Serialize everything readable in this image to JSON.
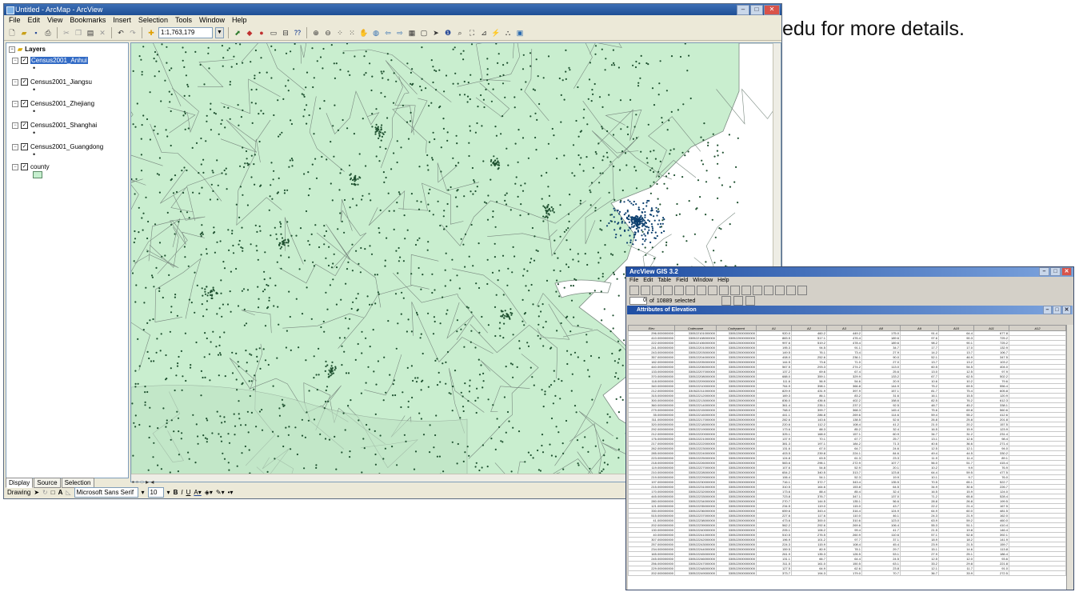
{
  "background_text": "edu for more details.",
  "arcmap": {
    "title": "Untitled - ArcMap - ArcView",
    "menu": [
      "File",
      "Edit",
      "View",
      "Bookmarks",
      "Insert",
      "Selection",
      "Tools",
      "Window",
      "Help"
    ],
    "scale": "1:1,763,179",
    "toc": {
      "root": "Layers",
      "layers": [
        {
          "name": "Census2001_Anhui",
          "symbol": "dot",
          "selected": true
        },
        {
          "name": "Census2001_Jiangsu",
          "symbol": "dot",
          "selected": false
        },
        {
          "name": "Census2001_Zhejiang",
          "symbol": "dot",
          "selected": false
        },
        {
          "name": "Census2001_Shanghai",
          "symbol": "dot",
          "selected": false
        },
        {
          "name": "Census2001_Guangdong",
          "symbol": "dot",
          "selected": false
        },
        {
          "name": "county",
          "symbol": "polygon",
          "selected": false
        }
      ],
      "tabs": [
        "Display",
        "Source",
        "Selection"
      ]
    },
    "drawing": {
      "label": "Drawing",
      "font": "Microsoft Sans Serif",
      "size": "10",
      "format": [
        "B",
        "I",
        "U"
      ]
    },
    "colors": {
      "land": "#c9eecf",
      "water": "#ffffff",
      "boundary": "#7a8a80",
      "dot": "#1f5130",
      "dot_dense": "#0c3f6e",
      "selection": "#316ac5"
    }
  },
  "arcview": {
    "title": "ArcView GIS 3.2",
    "menu": [
      "File",
      "Edit",
      "Table",
      "Field",
      "Window",
      "Help"
    ],
    "selected_label": "selected",
    "selected_count": "0",
    "of": "of",
    "total_count": "10889",
    "table_title": "Attributes of Elevation",
    "columns": [
      "Elev",
      "Codename",
      "Codeparent",
      "A1",
      "A2",
      "A3",
      "A8",
      "A9",
      "A10",
      "A11",
      "A12"
    ],
    "rows": [
      [
        "296.000000000",
        "330522101000000",
        "330522000000000",
        "920.0",
        "460.2",
        "449.2",
        "175.0",
        "91.4",
        "64.4",
        "677.8",
        ""
      ],
      [
        "410.000000000",
        "330522108000000",
        "330522000000000",
        "883.5",
        "517.1",
        "476.4",
        "189.6",
        "97.6",
        "90.3",
        "725.2",
        ""
      ],
      [
        "222.000000000",
        "330522106000000",
        "330522000000000",
        "997.6",
        "519.2",
        "478.4",
        "189.6",
        "98.2",
        "90.1",
        "725.2",
        ""
      ],
      [
        "241.000000000",
        "330522201000000",
        "330522000000000",
        "195.3",
        "94.5",
        "91.1",
        "34.7",
        "17.7",
        "17.0",
        "132.9",
        ""
      ],
      [
        "243.000000000",
        "330522203000000",
        "330522000000000",
        "149.5",
        "76.1",
        "73.4",
        "27.9",
        "14.2",
        "13.7",
        "106.7",
        ""
      ],
      [
        "357.000000000",
        "330522204000000",
        "330522000000000",
        "408.0",
        "252.6",
        "236.1",
        "90.0",
        "52.1",
        "46.9",
        "347.5",
        ""
      ],
      [
        "182.000000000",
        "330522205000000",
        "330522000000000",
        "144.5",
        "73.6",
        "71.0",
        "27.0",
        "13.7",
        "13.2",
        "103.2",
        ""
      ],
      [
        "440.000000000",
        "330522206000000",
        "330522000000000",
        "567.5",
        "293.3",
        "274.2",
        "113.0",
        "60.5",
        "54.5",
        "404.0",
        ""
      ],
      [
        "133.000000000",
        "330522207000000",
        "330522000000000",
        "137.2",
        "69.6",
        "67.4",
        "25.6",
        "13.0",
        "12.5",
        "97.9",
        ""
      ],
      [
        "370.000000000",
        "330522208000000",
        "330522000000000",
        "688.0",
        "359.1",
        "329.9",
        "133.2",
        "67.7",
        "62.5",
        "502.2",
        ""
      ],
      [
        "118.000000000",
        "330522209000000",
        "330522000000000",
        "111.6",
        "56.9",
        "54.6",
        "20.9",
        "10.6",
        "10.2",
        "79.6",
        ""
      ],
      [
        "340.000000000",
        "330522210000000",
        "330522000000000",
        "764.9",
        "398.1",
        "366.8",
        "144.9",
        "75.2",
        "69.5",
        "556.4",
        ""
      ],
      [
        "212.000000000",
        "330522211000000",
        "330522000000000",
        "829.9",
        "431.9",
        "397.9",
        "157.1",
        "81.7",
        "75.4",
        "605.8",
        ""
      ],
      [
        "315.000000000",
        "330522212000000",
        "330522000000000",
        "169.3",
        "86.1",
        "83.2",
        "31.6",
        "16.1",
        "15.5",
        "120.9",
        ""
      ],
      [
        "300.000000000",
        "330522213000000",
        "330522000000000",
        "836.0",
        "436.6",
        "402.2",
        "158.6",
        "82.5",
        "76.2",
        "612.3",
        ""
      ],
      [
        "360.000000000",
        "330522214000000",
        "330522000000000",
        "361.4",
        "235.1",
        "237.2",
        "92.5",
        "48.7",
        "45.2",
        "338.1",
        ""
      ],
      [
        "279.000000000",
        "330522215000000",
        "330522000000000",
        "768.0",
        "399.7",
        "368.3",
        "145.4",
        "75.6",
        "69.8",
        "560.6",
        ""
      ],
      [
        "35.000000000",
        "330522216000000",
        "330522000000000",
        "441.1",
        "286.8",
        "269.6",
        "114.6",
        "59.4",
        "55.2",
        "412.6",
        ""
      ],
      [
        "311.000000000",
        "330522217000000",
        "330522000000000",
        "282.6",
        "143.6",
        "138.5",
        "52.6",
        "26.8",
        "25.8",
        "201.8",
        ""
      ],
      [
        "320.000000000",
        "330522218000000",
        "330522000000000",
        "220.6",
        "112.2",
        "108.4",
        "41.2",
        "21.0",
        "20.2",
        "157.5",
        ""
      ],
      [
        "292.000000000",
        "330522219000000",
        "330522000000000",
        "173.6",
        "88.3",
        "85.2",
        "32.4",
        "16.5",
        "15.9",
        "123.9",
        ""
      ],
      [
        "212.000000000",
        "330522220000000",
        "330522000000000",
        "325.1",
        "168.0",
        "157.1",
        "60.9",
        "34.7",
        "31.2",
        "231.4",
        ""
      ],
      [
        "176.000000000",
        "330522221000000",
        "330522000000000",
        "137.9",
        "70.1",
        "67.7",
        "25.7",
        "13.1",
        "12.6",
        "98.4",
        ""
      ],
      [
        "217.000000000",
        "330522222000000",
        "330522000000000",
        "381.3",
        "197.1",
        "184.2",
        "71.3",
        "40.6",
        "36.6",
        "271.4",
        ""
      ],
      [
        "262.000000000",
        "330522223000000",
        "330522000000000",
        "131.6",
        "67.0",
        "64.7",
        "24.6",
        "12.5",
        "12.1",
        "94.0",
        ""
      ],
      [
        "285.000000000",
        "330522224000000",
        "330522000000000",
        "403.5",
        "239.8",
        "224.1",
        "84.6",
        "49.4",
        "44.5",
        "330.2",
        ""
      ],
      [
        "223.000000000",
        "330522225000000",
        "330522000000000",
        "124.8",
        "63.5",
        "61.3",
        "23.3",
        "11.9",
        "11.4",
        "89.1",
        ""
      ],
      [
        "218.000000000",
        "330522226000000",
        "330522000000000",
        "583.6",
        "296.1",
        "272.9",
        "107.7",
        "56.0",
        "51.7",
        "415.4",
        ""
      ],
      [
        "119.000000000",
        "330522227000000",
        "330522000000000",
        "107.6",
        "54.8",
        "52.9",
        "20.1",
        "10.2",
        "9.9",
        "76.9",
        ""
      ],
      [
        "210.000000000",
        "330522228000000",
        "330522000000000",
        "654.2",
        "340.5",
        "313.7",
        "123.8",
        "64.4",
        "59.5",
        "477.5",
        ""
      ],
      [
        "219.000000000",
        "330522229000000",
        "330522000000000",
        "106.4",
        "54.1",
        "52.3",
        "19.9",
        "10.1",
        "9.7",
        "76.0",
        ""
      ],
      [
        "197.000000000",
        "330522230000000",
        "330522000000000",
        "716.1",
        "372.7",
        "343.4",
        "135.5",
        "70.5",
        "65.1",
        "522.7",
        ""
      ],
      [
        "215.000000000",
        "330522231000000",
        "330522000000000",
        "310.5",
        "164.6",
        "153.8",
        "64.5",
        "34.9",
        "30.6",
        "226.7",
        ""
      ],
      [
        "170.000000000",
        "330522232000000",
        "330522000000000",
        "173.6",
        "88.4",
        "85.4",
        "32.4",
        "16.5",
        "15.9",
        "124.0",
        ""
      ],
      [
        "445.000000000",
        "330522233000000",
        "330522000000000",
        "723.8",
        "376.7",
        "347.1",
        "137.0",
        "71.2",
        "65.8",
        "528.4",
        ""
      ],
      [
        "280.000000000",
        "330522234000000",
        "330522000000000",
        "270.7",
        "144.5",
        "135.1",
        "56.6",
        "28.8",
        "26.8",
        "199.5",
        ""
      ],
      [
        "121.000000000",
        "330522235000000",
        "330522000000000",
        "234.5",
        "119.0",
        "115.0",
        "43.7",
        "22.2",
        "21.4",
        "167.5",
        ""
      ],
      [
        "330.000000000",
        "330522236000000",
        "330522000000000",
        "659.6",
        "343.4",
        "316.4",
        "124.9",
        "64.9",
        "60.0",
        "481.5",
        ""
      ],
      [
        "515.000000000",
        "330522237000000",
        "330522000000000",
        "227.6",
        "117.6",
        "110.0",
        "46.1",
        "24.3",
        "21.9",
        "162.0",
        ""
      ],
      [
        "41.000000000",
        "330522238000000",
        "330522000000000",
        "473.6",
        "300.0",
        "310.6",
        "123.0",
        "63.9",
        "59.2",
        "460.0",
        ""
      ],
      [
        "202.000000000",
        "330522239000000",
        "330522000000000",
        "562.2",
        "292.6",
        "269.6",
        "106.4",
        "55.3",
        "51.1",
        "410.4",
        ""
      ],
      [
        "130.000000000",
        "330522240000000",
        "330522000000000",
        "205.1",
        "106.2",
        "99.4",
        "41.7",
        "21.5",
        "19.8",
        "146.4",
        ""
      ],
      [
        "40.000000000",
        "330522241000000",
        "330522000000000",
        "510.5",
        "276.5",
        "260.9",
        "110.6",
        "57.1",
        "52.8",
        "392.1",
        ""
      ],
      [
        "307.000000000",
        "330522242000000",
        "330522000000000",
        "196.9",
        "101.2",
        "97.7",
        "37.1",
        "18.9",
        "18.2",
        "141.9",
        ""
      ],
      [
        "257.000000000",
        "330522243000000",
        "330522000000000",
        "224.3",
        "115.9",
        "108.4",
        "45.4",
        "23.9",
        "21.5",
        "159.7",
        ""
      ],
      [
        "234.000000000",
        "330522244000000",
        "330522000000000",
        "159.5",
        "80.9",
        "78.1",
        "29.7",
        "15.1",
        "14.6",
        "113.8",
        ""
      ],
      [
        "165.000000000",
        "330522245000000",
        "330522000000000",
        "261.9",
        "135.3",
        "126.5",
        "53.1",
        "27.9",
        "25.1",
        "186.4",
        ""
      ],
      [
        "245.000000000",
        "330522246000000",
        "330522000000000",
        "131.1",
        "66.7",
        "64.4",
        "24.5",
        "12.5",
        "12.0",
        "93.6",
        ""
      ],
      [
        "256.000000000",
        "330522247000000",
        "330522000000000",
        "311.5",
        "161.0",
        "150.5",
        "63.1",
        "33.2",
        "29.8",
        "221.8",
        ""
      ],
      [
        "229.000000000",
        "330522248000000",
        "330522000000000",
        "127.5",
        "64.9",
        "62.6",
        "23.8",
        "12.1",
        "11.7",
        "91.0",
        ""
      ],
      [
        "202.000000000",
        "330522249000000",
        "330522000000000",
        "373.7",
        "194.3",
        "179.0",
        "70.7",
        "36.7",
        "33.9",
        "272.5",
        ""
      ]
    ]
  }
}
